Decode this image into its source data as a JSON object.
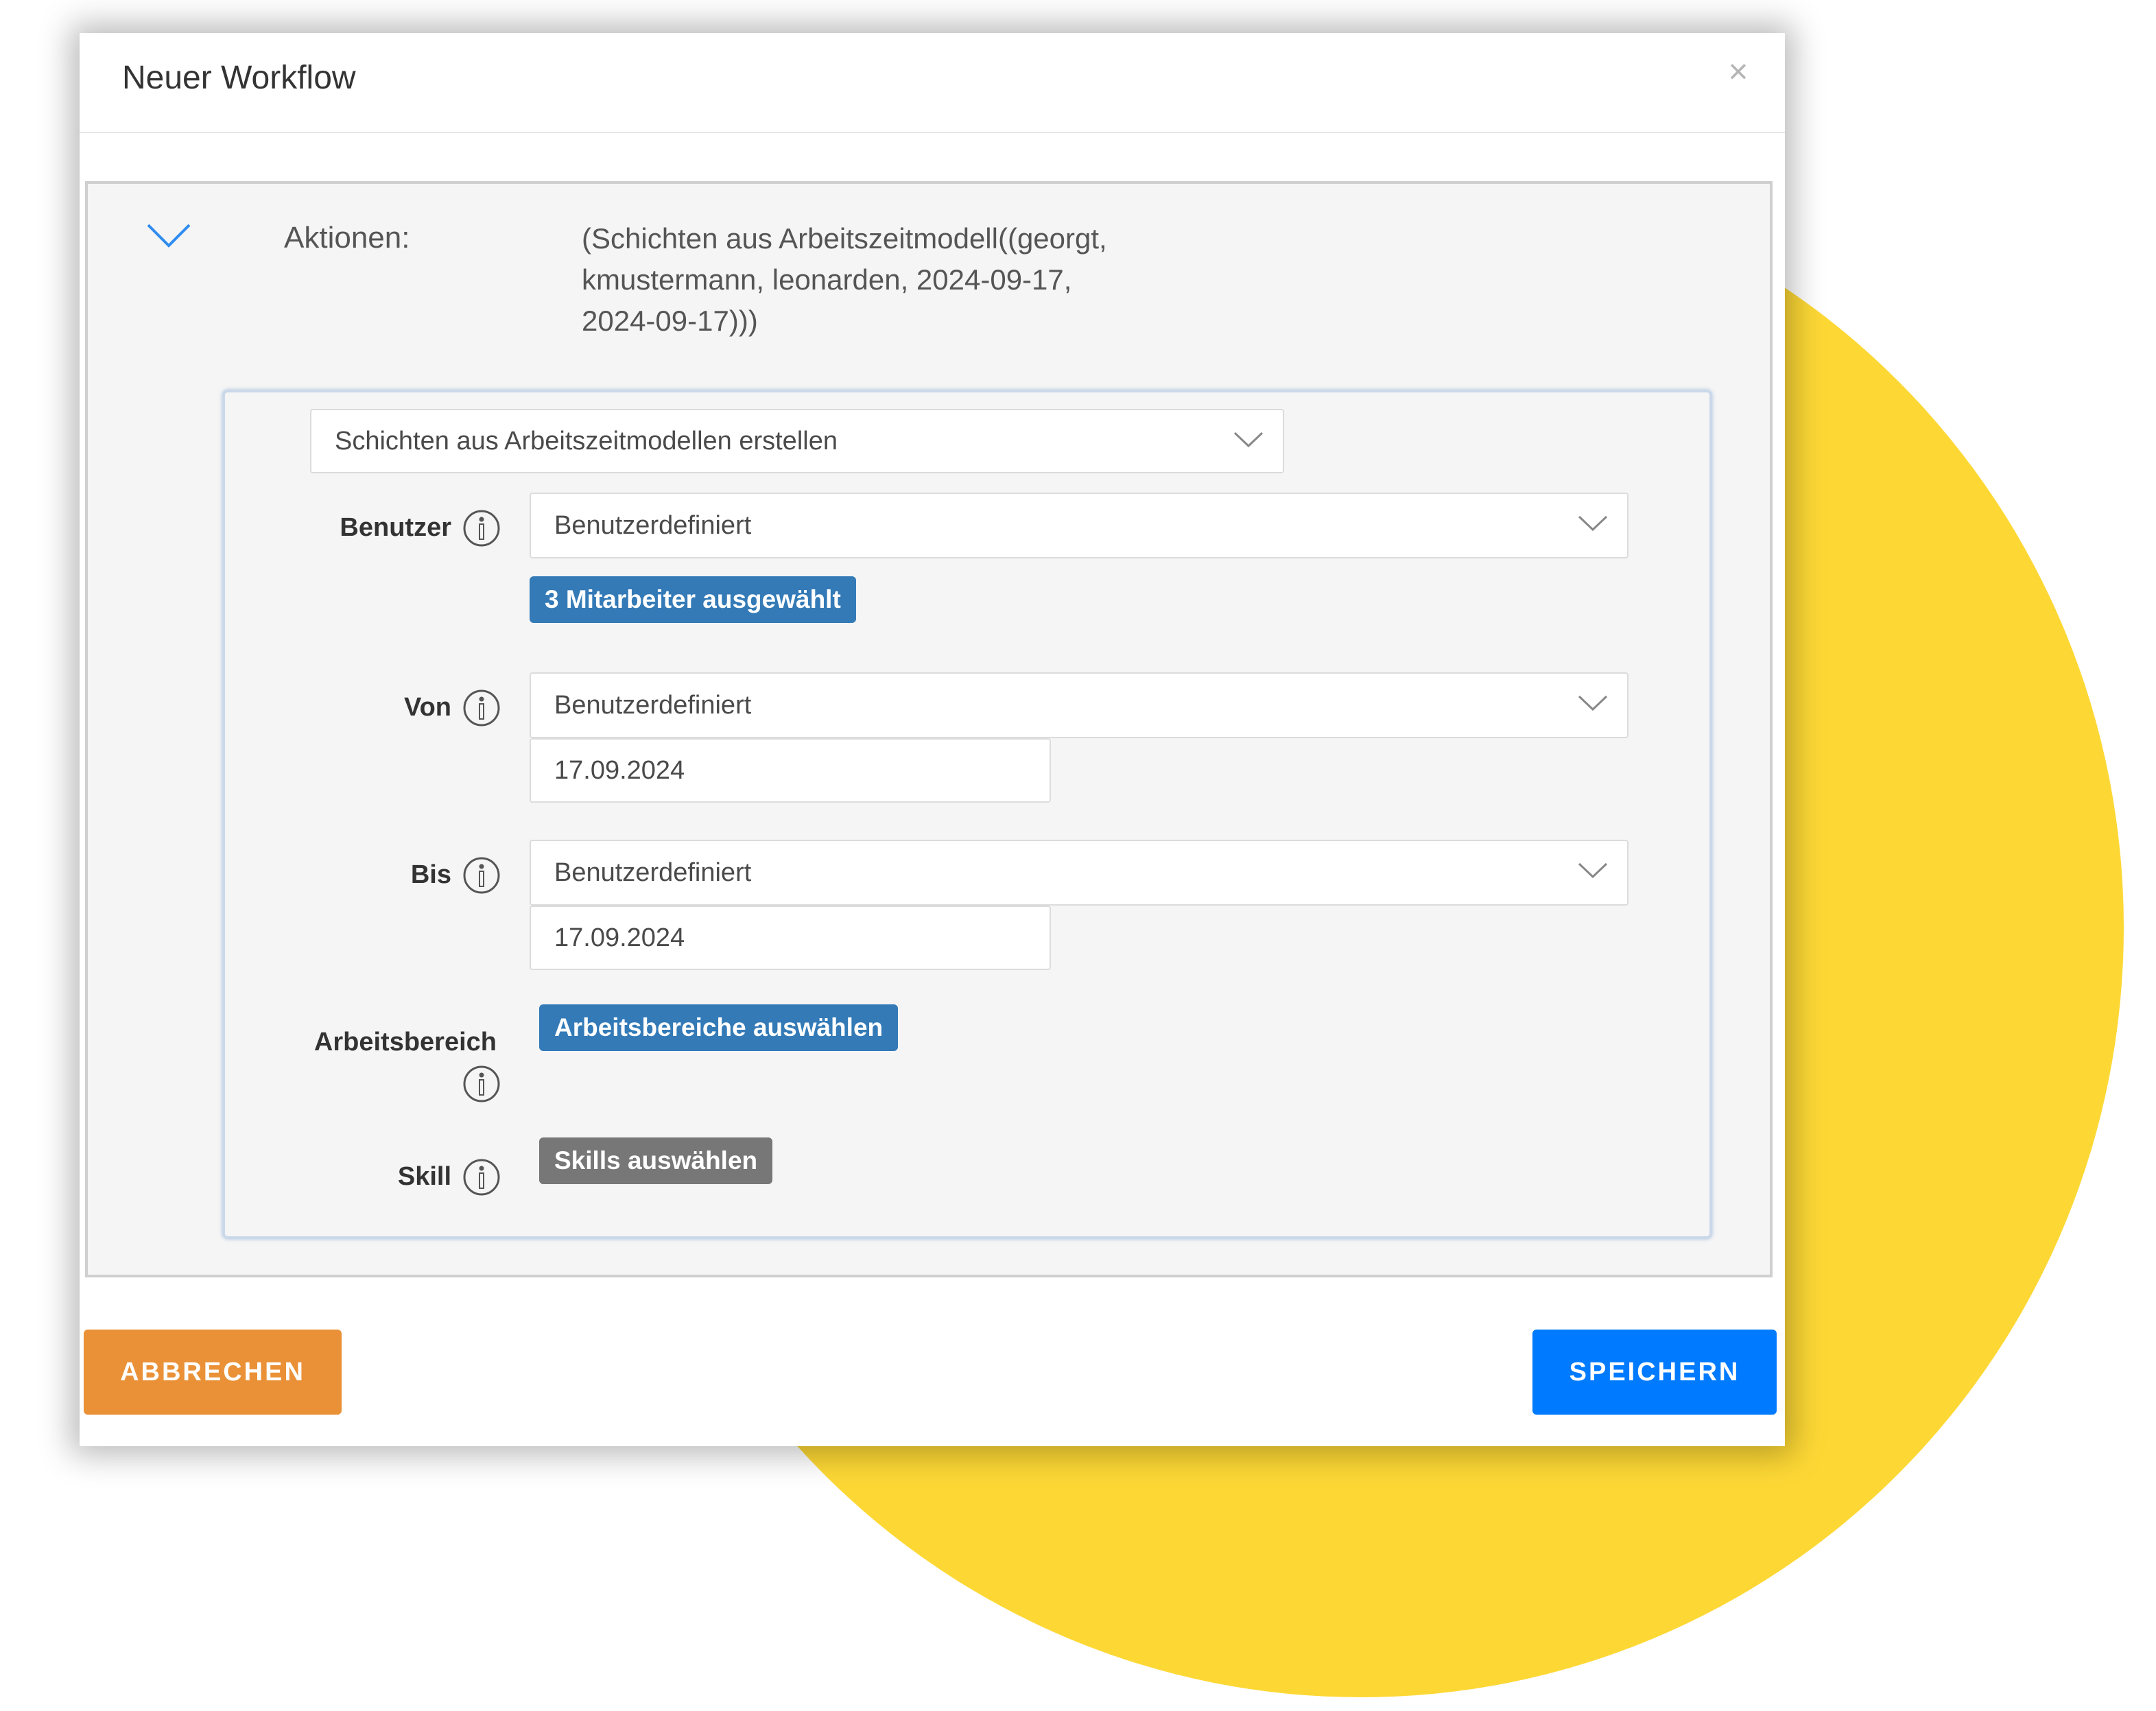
{
  "colors": {
    "background_circle": "#fdd835",
    "badge_blue": "#337ab7",
    "badge_gray": "#777777",
    "cancel_orange": "#ea9137",
    "save_blue": "#007bff",
    "collapse_chevron": "#2f8cf0"
  },
  "modal": {
    "title": "Neuer Workflow",
    "close_label": "×"
  },
  "actions": {
    "label": "Aktionen:",
    "summary_lines": [
      "(Schichten aus Arbeitszeitmodell((georgt,",
      "kmustermann, leonarden, 2024-09-17,",
      "2024-09-17)))"
    ],
    "collapse_icon": "chevron-down-icon"
  },
  "action_editor": {
    "action_type": "Schichten aus Arbeitszeitmodellen erstellen",
    "benutzer": {
      "label": "Benutzer",
      "select_value": "Benutzerdefiniert",
      "badge": "3 Mitarbeiter ausgewählt"
    },
    "von": {
      "label": "Von",
      "select_value": "Benutzerdefiniert",
      "date": "17.09.2024"
    },
    "bis": {
      "label": "Bis",
      "select_value": "Benutzerdefiniert",
      "date": "17.09.2024"
    },
    "arbeitsbereich": {
      "label": "Arbeitsbereich",
      "button": "Arbeitsbereiche auswählen"
    },
    "skill": {
      "label": "Skill",
      "button": "Skills auswählen"
    },
    "info_icon": "info-circle-icon",
    "dropdown_icon": "chevron-down-icon"
  },
  "footer": {
    "cancel_label": "ABBRECHEN",
    "save_label": "SPEICHERN"
  }
}
